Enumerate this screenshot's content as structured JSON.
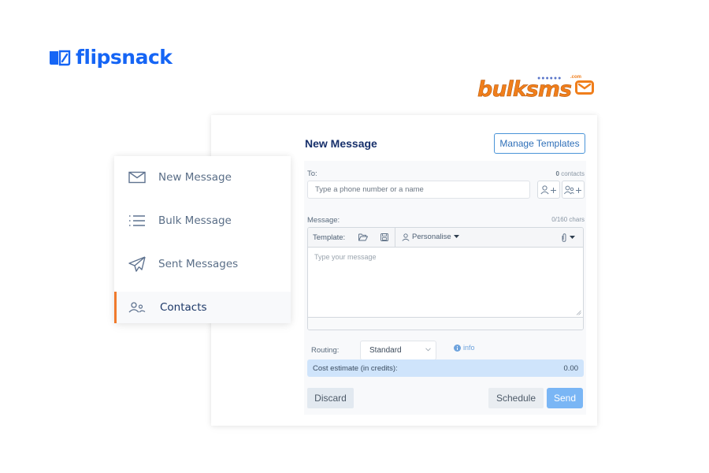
{
  "logos": {
    "flipsnack": "flipsnack",
    "bulksms": {
      "bulk": "bulk",
      "sms": "sms",
      "com": ".com"
    }
  },
  "colors": {
    "flipsnack_blue": "#1565f5",
    "bulksms_orange": "#f07e1b",
    "active_accent": "#f07a2c",
    "send_button": "#7ab6f5",
    "cost_bar": "#cfe4fb",
    "title": "#17306b"
  },
  "sidebar": {
    "items": [
      {
        "label": "New Message",
        "icon": "envelope-icon",
        "active": false
      },
      {
        "label": "Bulk Message",
        "icon": "list-icon",
        "active": false
      },
      {
        "label": "Sent Messages",
        "icon": "paper-plane-icon",
        "active": false
      },
      {
        "label": "Contacts",
        "icon": "contacts-icon",
        "active": true
      }
    ]
  },
  "compose": {
    "title": "New Message",
    "manage_templates_label": "Manage Templates",
    "to": {
      "label": "To:",
      "count_value": "0",
      "count_unit": "contacts",
      "placeholder": "Type a phone number or a name",
      "value": ""
    },
    "message": {
      "label": "Message:",
      "char_count": "0/160 chars",
      "toolbar": {
        "template_label": "Template:",
        "personalise_label": "Personalise"
      },
      "placeholder": "Type your message",
      "value": ""
    },
    "routing": {
      "label": "Routing:",
      "selected": "Standard",
      "info_label": "info"
    },
    "cost": {
      "label": "Cost estimate (in credits):",
      "value": "0.00"
    },
    "buttons": {
      "discard": "Discard",
      "schedule": "Schedule",
      "send": "Send"
    }
  }
}
